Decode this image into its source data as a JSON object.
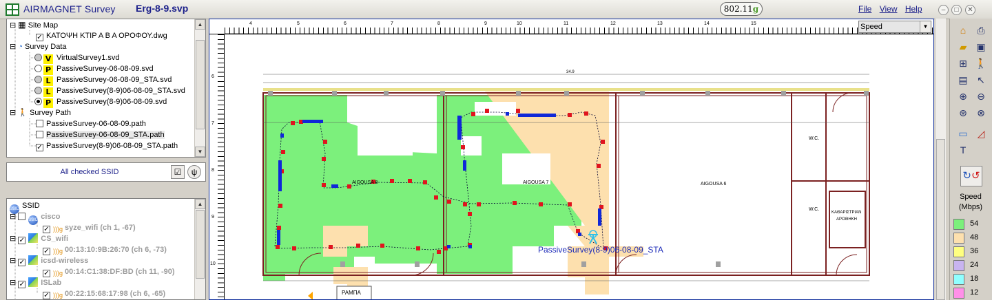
{
  "app": {
    "name": "AIRMAGNET Survey",
    "document": "Erg-8-9.svp",
    "badge": {
      "text": "802.11",
      "suffix": "g"
    },
    "menu": [
      "File",
      "View",
      "Help"
    ]
  },
  "tree": {
    "site_map_label": "Site Map",
    "site_map_file": "ΚΑΤΟΨΗ ΚΤΙΡ Α Β Α ΟΡΟΦΟΥ.dwg",
    "survey_data_label": "Survey Data",
    "surveys": [
      {
        "tag": "V",
        "name": "VirtualSurvey1.svd"
      },
      {
        "tag": "P",
        "name": "PassiveSurvey-06-08-09.svd"
      },
      {
        "tag": "L",
        "name": "PassiveSurvey-06-08-09_STA.svd"
      },
      {
        "tag": "L",
        "name": "PassiveSurvey(8-9)06-08-09_STA.svd"
      },
      {
        "tag": "P",
        "name": "PassiveSurvey(8-9)06-08-09.svd"
      }
    ],
    "survey_path_label": "Survey Path",
    "paths": [
      "PassiveSurvey-06-08-09.path",
      "PassiveSurvey-06-08-09_STA.path",
      "PassiveSurvey(8-9)06-08-09_STA.path"
    ]
  },
  "ssid": {
    "header": "All checked SSID",
    "root": "SSID",
    "networks": [
      {
        "name": "cisco",
        "ap": "syze_wifi (ch 1, -67)"
      },
      {
        "name": "CS_wifi",
        "ap": "00:13:10:9B:26:70 (ch 6, -73)"
      },
      {
        "name": "icsd-wireless",
        "ap": "00:14:C1:38:DF:BD (ch 11, -90)"
      },
      {
        "name": "ISLab",
        "ap": "00:22:15:68:17:98 (ch 6, -65)"
      }
    ]
  },
  "map": {
    "ruler_top": [
      "4",
      "5",
      "6",
      "7",
      "8",
      "9",
      "10",
      "11",
      "12",
      "13",
      "14",
      "15"
    ],
    "ruler_left": [
      "6",
      "7",
      "8",
      "9",
      "10"
    ],
    "rooms": [
      "AIGOUSA 8",
      "AIGOUSA 7",
      "AIGOUSA 6",
      "W.C.",
      "W.C.",
      "ΚΑΘΑΡΙΣΤΡΙΑΝ",
      "ΑΡΟΘΗΚΗ",
      "ΡΑΜΠΑ"
    ],
    "path_label": "PassiveSurvey(8-9)06-08-09_STA",
    "overall_dim": "34.9"
  },
  "speed_select": "Speed",
  "legend": {
    "title": "Speed",
    "unit": "(Mbps)",
    "items": [
      {
        "value": "54",
        "color": "#7cf07c"
      },
      {
        "value": "48",
        "color": "#fde0ae"
      },
      {
        "value": "36",
        "color": "#ffff80"
      },
      {
        "value": "24",
        "color": "#c8b4f0"
      },
      {
        "value": "18",
        "color": "#90ffff"
      },
      {
        "value": "12",
        "color": "#ff90e8"
      }
    ]
  }
}
